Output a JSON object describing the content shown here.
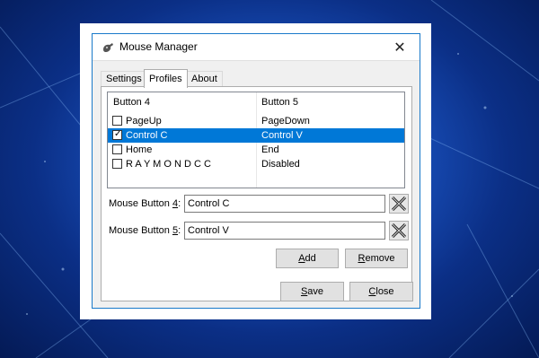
{
  "window": {
    "title": "Mouse Manager",
    "close_glyph": "✕",
    "app_icon": "mouse-icon"
  },
  "tabs": [
    {
      "label": "Settings",
      "active": false
    },
    {
      "label": "Profiles",
      "active": true
    },
    {
      "label": "About",
      "active": false
    }
  ],
  "list": {
    "headers": [
      "Button 4",
      "Button 5"
    ],
    "rows": [
      {
        "checked": false,
        "selected": false,
        "button4": "PageUp",
        "button5": "PageDown"
      },
      {
        "checked": true,
        "selected": true,
        "button4": "Control C",
        "button5": "Control V"
      },
      {
        "checked": false,
        "selected": false,
        "button4": "Home",
        "button5": "End"
      },
      {
        "checked": false,
        "selected": false,
        "button4": "R A Y M O N D C C",
        "button5": "Disabled"
      }
    ]
  },
  "fields": {
    "button4": {
      "label_prefix": "Mouse Button ",
      "label_key": "4",
      "label_suffix": ":",
      "value": "Control C"
    },
    "button5": {
      "label_prefix": "Mouse Button ",
      "label_key": "5",
      "label_suffix": ":",
      "value": "Control V"
    }
  },
  "buttons": {
    "add": {
      "key": "A",
      "rest": "dd"
    },
    "remove": {
      "key": "R",
      "rest": "emove"
    },
    "save": {
      "key": "S",
      "rest": "ave"
    },
    "close": {
      "key": "C",
      "rest": "lose"
    }
  },
  "colors": {
    "selection": "#0078d7",
    "window_border": "#1979ca"
  }
}
